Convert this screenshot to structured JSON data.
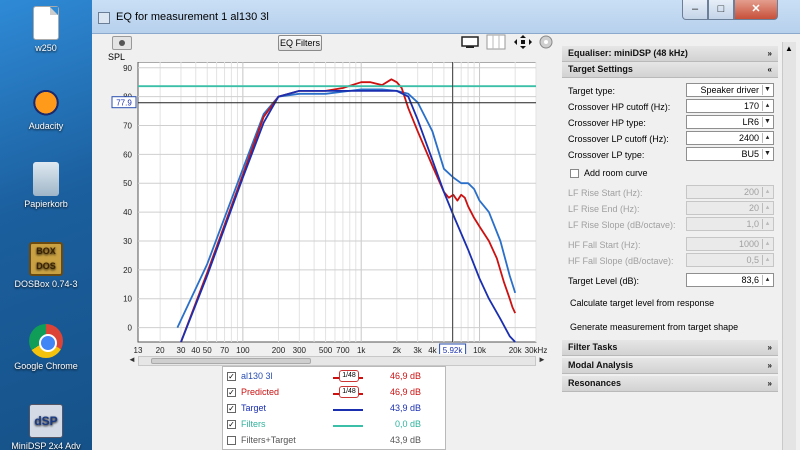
{
  "desktop": {
    "icons": [
      {
        "label": "w250",
        "icon": "document-icon"
      },
      {
        "label": "Audacity",
        "icon": "audacity-icon"
      },
      {
        "label": "Papierkorb",
        "icon": "recycle-bin-icon"
      },
      {
        "label": "DOSBox 0.74-3",
        "icon": "dosbox-icon"
      },
      {
        "label": "Google Chrome",
        "icon": "chrome-icon"
      },
      {
        "label": "MiniDSP 2x4 Adv",
        "icon": "minidsp-icon"
      }
    ]
  },
  "window": {
    "title": "EQ for measurement 1 al130 3l",
    "controls": {
      "minimize": "–",
      "maximize": "□",
      "close": "✕"
    }
  },
  "toolbar": {
    "eq_filters_label": "EQ Filters"
  },
  "graph": {
    "y_axis_label": "SPL",
    "y_ticks": [
      "90",
      "80",
      "70",
      "60",
      "50",
      "40",
      "30",
      "20",
      "10",
      "0"
    ],
    "x_ticks": [
      "13",
      "20",
      "30",
      "40",
      "50",
      "70",
      "100",
      "200",
      "300",
      "500",
      "700",
      "1k",
      "2k",
      "3k",
      "4k",
      "5k",
      "7k",
      "10k",
      "20k",
      "30kHz"
    ],
    "cursor_y_value": "77.9",
    "cursor_x_value": "5.92k",
    "scroll_left": "◄",
    "scroll_right": "►"
  },
  "chart_data": {
    "type": "line",
    "xlabel": "",
    "ylabel": "SPL",
    "x_scale": "log",
    "xlim": [
      13,
      30000
    ],
    "ylim": [
      -5,
      92
    ],
    "grid": true,
    "series": [
      {
        "name": "al130 3l",
        "color": "#2a6fc9",
        "x": [
          28,
          50,
          100,
          150,
          200,
          300,
          500,
          800,
          1000,
          1500,
          2000,
          2500,
          3000,
          4000,
          5000,
          6000,
          7000,
          8000,
          9000,
          10000,
          12000,
          15000,
          18000,
          20000
        ],
        "y": [
          0,
          22,
          55,
          74,
          80,
          81,
          81,
          82,
          82.5,
          82.5,
          82,
          81,
          78,
          68,
          55,
          52,
          50,
          50,
          48,
          44,
          40,
          30,
          18,
          12
        ]
      },
      {
        "name": "Predicted",
        "color": "#cc1111",
        "x": [
          30,
          50,
          100,
          150,
          200,
          300,
          500,
          700,
          1000,
          1200,
          1500,
          1800,
          2000,
          2200,
          2500,
          3000,
          4000,
          5000,
          5500,
          6000,
          6500,
          7000,
          7500,
          8000,
          9000,
          10000,
          12000,
          14000,
          16000,
          18000,
          19000,
          20000
        ],
        "y": [
          -5,
          19,
          53,
          73,
          80,
          82,
          82,
          83,
          85,
          85,
          84,
          86,
          85,
          83,
          76,
          68,
          56,
          47,
          45,
          46,
          44,
          46,
          45,
          42,
          38,
          35,
          30,
          24,
          16,
          10,
          7,
          5
        ]
      },
      {
        "name": "Target",
        "color": "#1a2fb0",
        "x": [
          30,
          50,
          100,
          150,
          200,
          300,
          500,
          1000,
          1500,
          2000,
          2500,
          3000,
          4000,
          5000,
          6000,
          8000,
          10000,
          12000,
          15000,
          18000,
          20000
        ],
        "y": [
          -5,
          18,
          52,
          71,
          80,
          82,
          82,
          82,
          82,
          82,
          80,
          72,
          58,
          47,
          39,
          27,
          17,
          10,
          3,
          -3,
          -5
        ]
      },
      {
        "name": "Filters",
        "color": "#3cbfa9",
        "x": [
          13,
          30000
        ],
        "y": [
          83.6,
          83.6
        ]
      }
    ],
    "legend": [
      {
        "name": "al130 3l",
        "checked": true,
        "value": "46,9 dB",
        "smoothing": "1/48"
      },
      {
        "name": "Predicted",
        "checked": true,
        "value": "46,9 dB",
        "smoothing": "1/48"
      },
      {
        "name": "Target",
        "checked": true,
        "value": "43,9 dB"
      },
      {
        "name": "Filters",
        "checked": true,
        "value": "0,0 dB"
      },
      {
        "name": "Filters+Target",
        "checked": false,
        "value": "43,9 dB"
      }
    ]
  },
  "equaliser": {
    "header": "Equaliser: miniDSP (48 kHz)",
    "target_settings_header": "Target Settings",
    "fields": [
      {
        "label": "Target type:",
        "value": "Speaker driver",
        "enabled": true,
        "dropdown": true
      },
      {
        "label": "Crossover HP cutoff (Hz):",
        "value": "170",
        "enabled": true,
        "dropdown": false
      },
      {
        "label": "Crossover HP type:",
        "value": "LR6",
        "enabled": true,
        "dropdown": true
      },
      {
        "label": "Crossover LP cutoff (Hz):",
        "value": "2400",
        "enabled": true,
        "dropdown": false
      },
      {
        "label": "Crossover LP type:",
        "value": "BU5",
        "enabled": true,
        "dropdown": true
      }
    ],
    "add_room_curve": "Add room curve",
    "room_fields": [
      {
        "label": "LF Rise Start (Hz):",
        "value": "200"
      },
      {
        "label": "LF Rise End (Hz):",
        "value": "20"
      },
      {
        "label": "LF Rise Slope (dB/octave):",
        "value": "1,0"
      },
      {
        "label": "HF Fall Start (Hz):",
        "value": "1000"
      },
      {
        "label": "HF Fall Slope (dB/octave):",
        "value": "0,5"
      }
    ],
    "target_level_label": "Target Level (dB):",
    "target_level_value": "83,6",
    "calc_target_label": "Calculate target level from response",
    "generate_label": "Generate measurement from target shape",
    "filter_tasks_header": "Filter Tasks",
    "modal_analysis_header": "Modal Analysis",
    "resonances_header": "Resonances"
  }
}
